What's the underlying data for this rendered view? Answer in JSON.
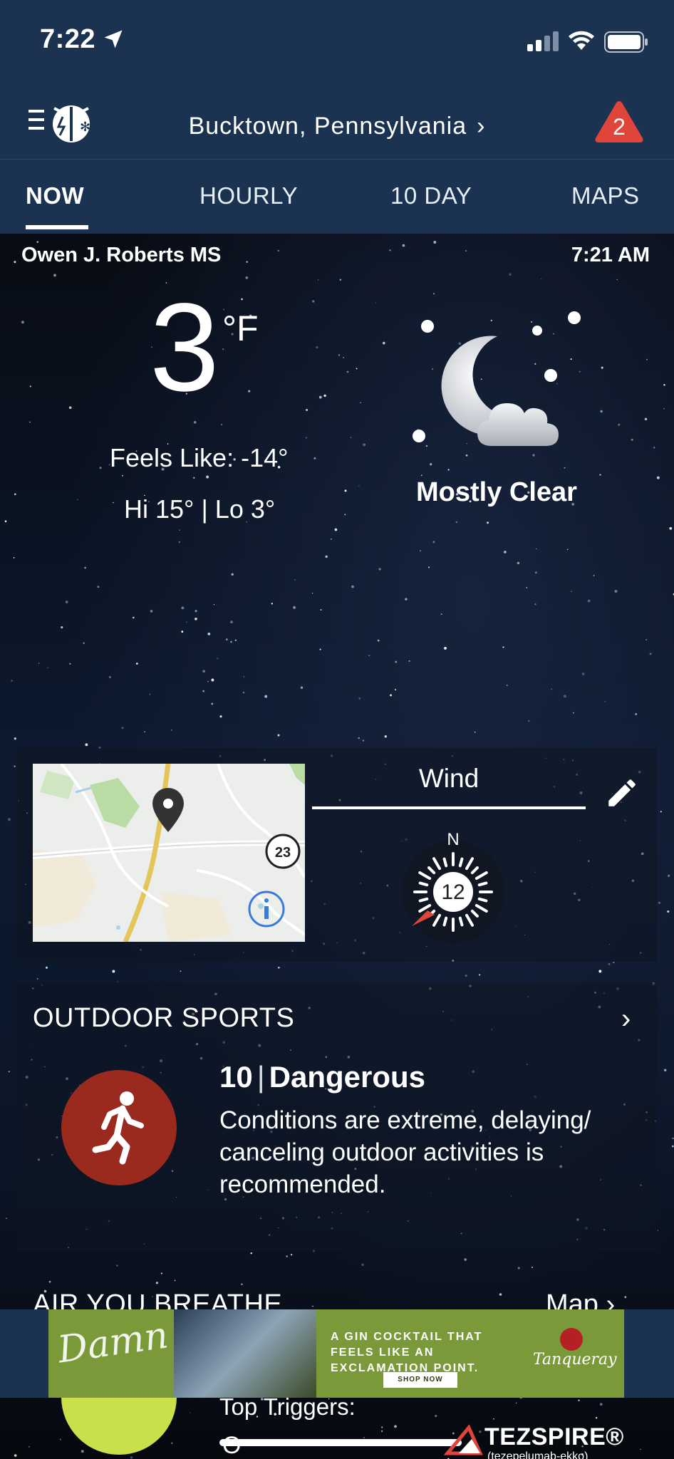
{
  "status_bar": {
    "time": "7:22",
    "icons": [
      "location-arrow-icon",
      "signal-icon",
      "wifi-icon",
      "battery-icon"
    ]
  },
  "header": {
    "menu_icon": "menu-icon",
    "logo_icon": "weatherbug-logo-icon",
    "location": "Bucktown,  Pennsylvania",
    "chevron": "›",
    "alert_count": "2",
    "alert_icon": "warning-triangle-icon"
  },
  "tabs": [
    {
      "label": "NOW",
      "active": true
    },
    {
      "label": "HOURLY",
      "active": false
    },
    {
      "label": "10  DAY",
      "active": false
    },
    {
      "label": "MAPS",
      "active": false
    }
  ],
  "observation": {
    "station": "Owen J. Roberts MS",
    "time": "7:21 AM",
    "temperature": "3",
    "unit": "°F",
    "feels_like": "Feels Like: -14°",
    "hi_lo": "Hi 15° | Lo 3°",
    "condition": "Mostly Clear",
    "condition_icon": "moon-cloud-icon"
  },
  "map_card": {
    "highway_shield": "23",
    "pin_icon": "map-pin-icon",
    "info_icon": "info-icon"
  },
  "wind": {
    "title": "Wind",
    "direction_label": "N",
    "speed": "12",
    "edit_icon": "pencil-icon"
  },
  "outdoor_sports": {
    "title": "OUTDOOR SPORTS",
    "chevron": "›",
    "rating_value": "10",
    "rating_separator": "|",
    "rating_label": "Dangerous",
    "description": "Conditions are extreme, delaying/ canceling outdoor activities is recommended.",
    "icon": "runner-icon",
    "color": "#9a2a1e"
  },
  "air": {
    "title": "AIR YOU BREATHE",
    "map_link": "Map",
    "chevron": "›",
    "top_triggers_label": "Top Triggers:",
    "trigger": "O",
    "color": "#c9e04a"
  },
  "ad": {
    "script_text": "Damn Fancy",
    "headline": "A GIN COCKTAIL THAT FEELS LIKE AN EXCLAMATION POINT.",
    "cta": "SHOP NOW",
    "brand": "Tanqueray"
  },
  "sponsor": {
    "name": "TEZSPIRE®",
    "subtitle": "(tezepelumab-ekko)"
  }
}
